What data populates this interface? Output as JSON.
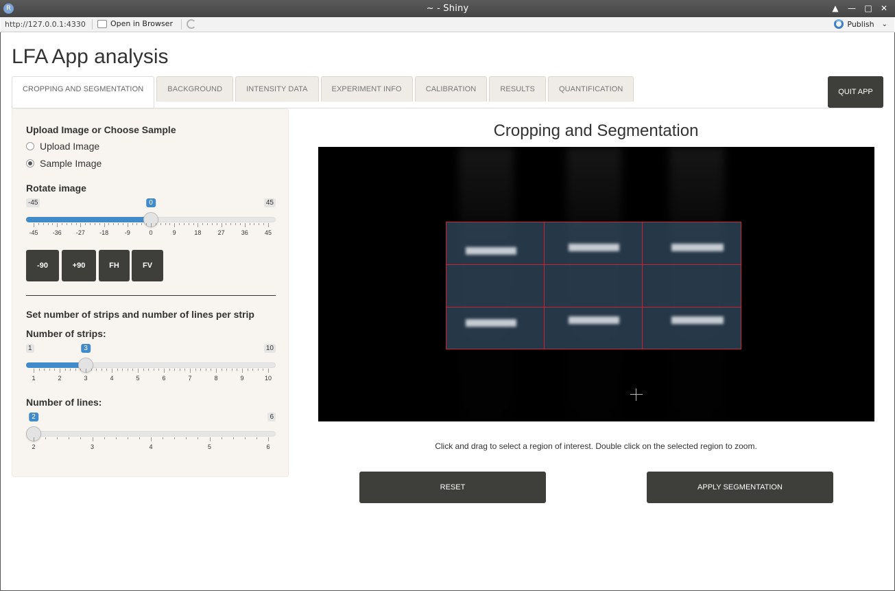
{
  "window": {
    "title": "~ - Shiny",
    "app_icon": "R",
    "controls": [
      "▲",
      "—",
      "□",
      "✕"
    ]
  },
  "addressbar": {
    "url": "http://127.0.0.1:4330",
    "open_browser_label": "Open in Browser",
    "publish_label": "Publish",
    "publish_caret": "⌄"
  },
  "app": {
    "title": "LFA App analysis",
    "quit_label": "QUIT APP",
    "tabs": [
      {
        "label": "CROPPING AND SEGMENTATION",
        "active": true
      },
      {
        "label": "BACKGROUND"
      },
      {
        "label": "INTENSITY DATA"
      },
      {
        "label": "EXPERIMENT INFO"
      },
      {
        "label": "CALIBRATION"
      },
      {
        "label": "RESULTS"
      },
      {
        "label": "QUANTIFICATION"
      }
    ]
  },
  "sidebar": {
    "upload_heading": "Upload Image or Choose Sample",
    "radio_options": [
      {
        "label": "Upload Image",
        "selected": false
      },
      {
        "label": "Sample Image",
        "selected": true
      }
    ],
    "rotate_label": "Rotate image",
    "rotate_slider": {
      "min": -45,
      "max": 45,
      "value": 0,
      "ticks": [
        "-45",
        "-36",
        "-27",
        "-18",
        "-9",
        "0",
        "9",
        "18",
        "27",
        "36",
        "45"
      ]
    },
    "buttons": {
      "rot_minus": "-90",
      "rot_plus": "+90",
      "flip_h": "FH",
      "flip_v": "FV"
    },
    "strips_section_title": "Set number of strips and number of lines per strip",
    "strips_label": "Number of strips:",
    "strips_slider": {
      "min": 1,
      "max": 10,
      "value": 3,
      "ticks": [
        "1",
        "2",
        "3",
        "4",
        "5",
        "6",
        "7",
        "8",
        "9",
        "10"
      ]
    },
    "lines_label": "Number of lines:",
    "lines_slider": {
      "min": 2,
      "max": 6,
      "value": 2,
      "ticks": [
        "2",
        "3",
        "4",
        "5",
        "6"
      ]
    }
  },
  "main": {
    "title": "Cropping and Segmentation",
    "hint": "Click and drag to select a region of interest. Double click on the selected region to zoom.",
    "reset_label": "RESET",
    "apply_label": "APPLY SEGMENTATION",
    "grid": {
      "columns": 3,
      "rows": 3
    }
  },
  "colors": {
    "accent": "#428bca",
    "button_dark": "#3e3f3a",
    "sidebar_bg": "#f8f5f0",
    "roi_line": "#cc2233"
  }
}
